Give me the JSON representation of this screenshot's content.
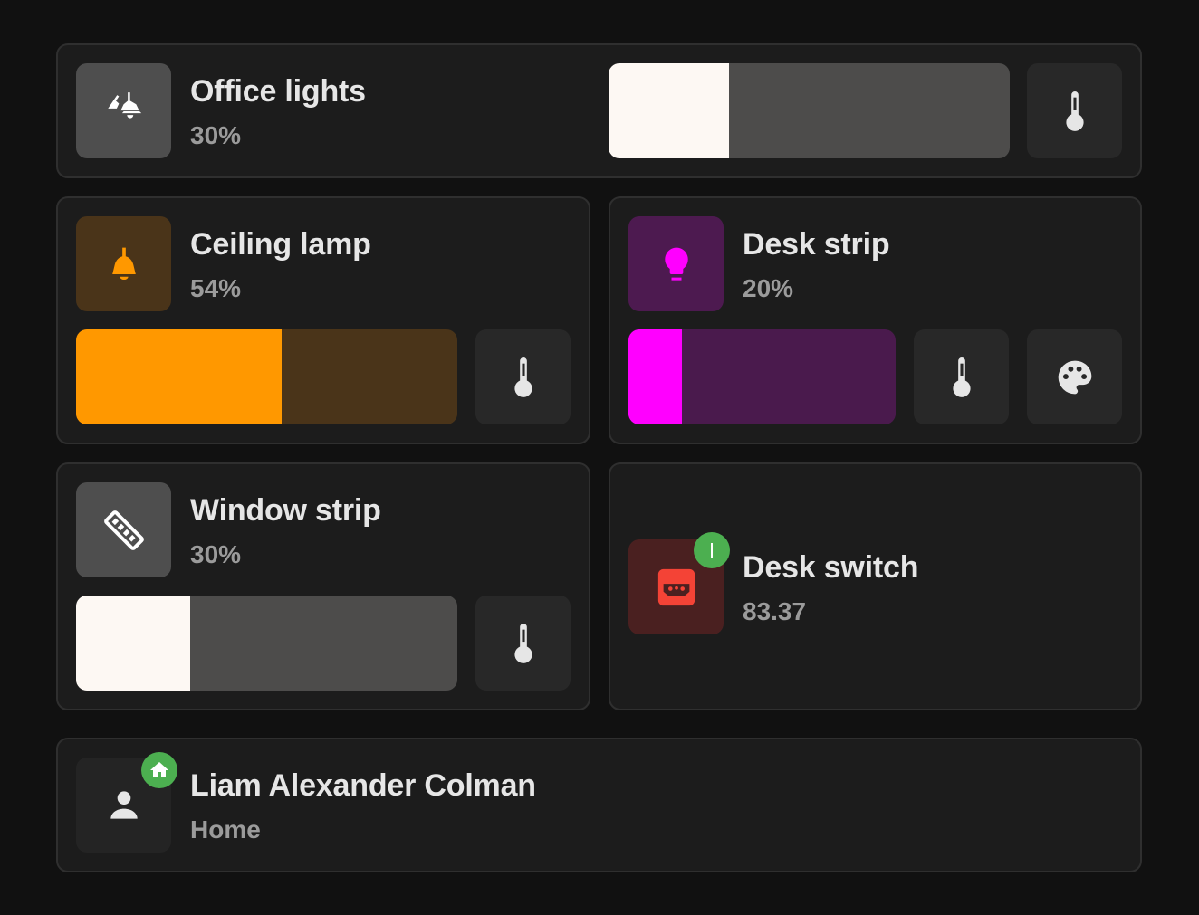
{
  "colors": {
    "background": "#111111",
    "card": "#1c1c1c",
    "white_light": "#fdf8f3",
    "orange": "#ff9800",
    "magenta": "#ff00ff",
    "red": "#f44336",
    "green_badge": "#4caf50"
  },
  "office_lights": {
    "name": "Office lights",
    "state": "30%",
    "brightness": 30,
    "icon": "ceiling-light-multiple-icon"
  },
  "ceiling_lamp": {
    "name": "Ceiling lamp",
    "state": "54%",
    "brightness": 54,
    "icon": "ceiling-lamp-icon"
  },
  "desk_strip": {
    "name": "Desk strip",
    "state": "20%",
    "brightness": 20,
    "icon": "lightbulb-icon"
  },
  "window_strip": {
    "name": "Window strip",
    "state": "30%",
    "brightness": 30,
    "icon": "led-strip-icon"
  },
  "desk_switch": {
    "name": "Desk switch",
    "state": "83.37",
    "icon": "power-socket-icon",
    "badge_icon": "power-on-icon"
  },
  "person": {
    "name": "Liam Alexander Colman",
    "state": "Home",
    "icon": "account-icon",
    "badge_icon": "home-icon"
  }
}
